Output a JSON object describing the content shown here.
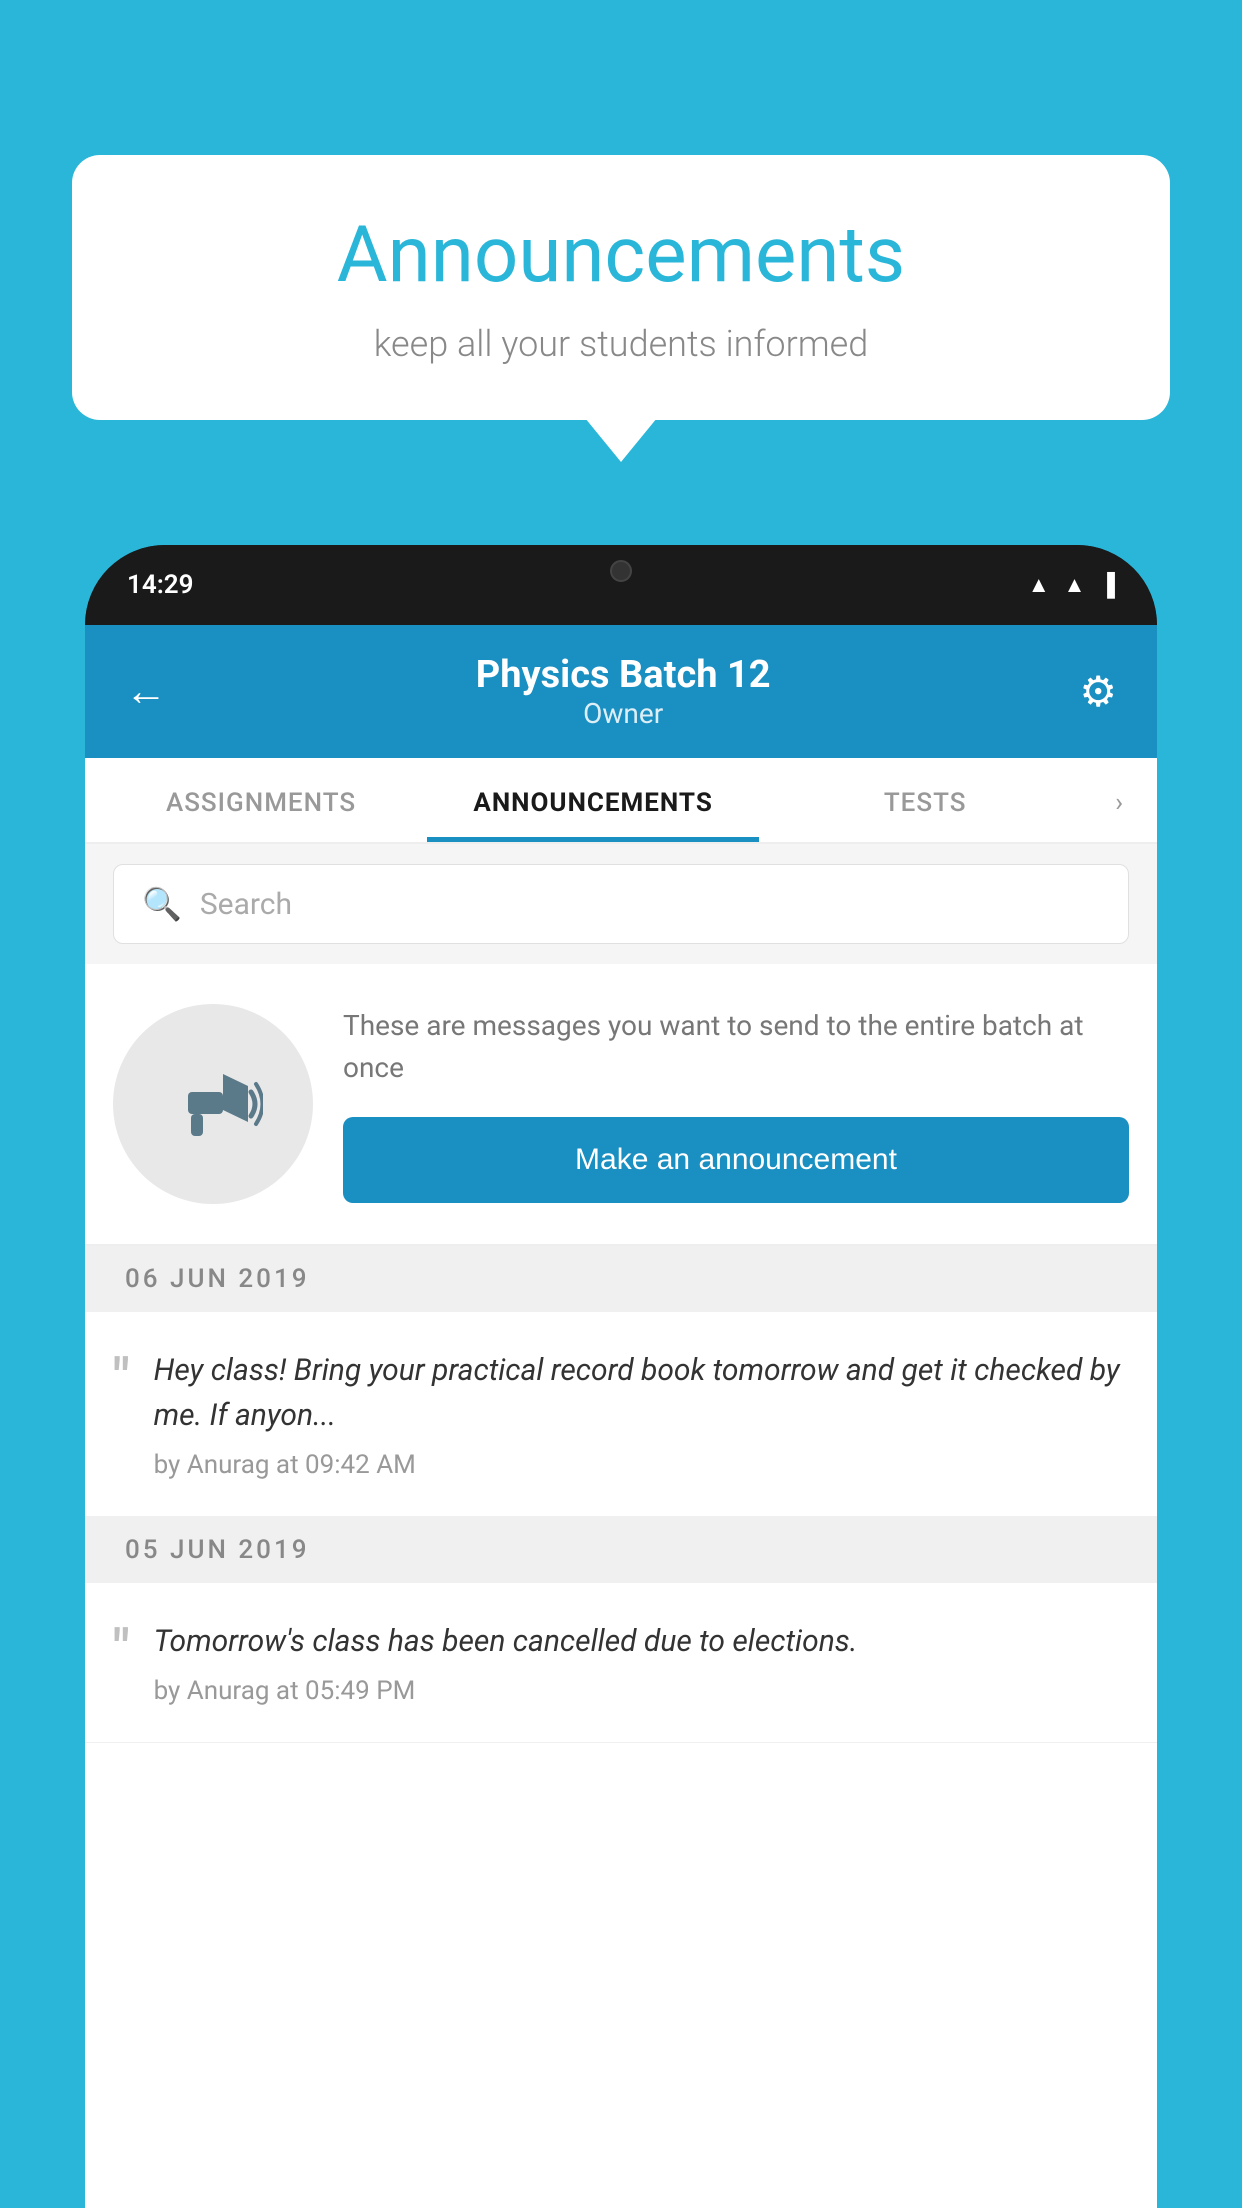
{
  "background_color": "#29b6d8",
  "speech_bubble": {
    "title": "Announcements",
    "subtitle": "keep all your students informed"
  },
  "status_bar": {
    "time": "14:29",
    "icons": [
      "wifi",
      "signal",
      "battery"
    ]
  },
  "app_header": {
    "back_label": "←",
    "title": "Physics Batch 12",
    "subtitle": "Owner",
    "gear_label": "⚙"
  },
  "tabs": [
    {
      "label": "ASSIGNMENTS",
      "active": false
    },
    {
      "label": "ANNOUNCEMENTS",
      "active": true
    },
    {
      "label": "TESTS",
      "active": false
    }
  ],
  "search": {
    "placeholder": "Search"
  },
  "promo": {
    "description": "These are messages you want to send to the entire batch at once",
    "button_label": "Make an announcement"
  },
  "date_groups": [
    {
      "date": "06  JUN  2019",
      "announcements": [
        {
          "text": "Hey class! Bring your practical record book tomorrow and get it checked by me. If anyon...",
          "meta": "by Anurag at 09:42 AM"
        }
      ]
    },
    {
      "date": "05  JUN  2019",
      "announcements": [
        {
          "text": "Tomorrow's class has been cancelled due to elections.",
          "meta": "by Anurag at 05:49 PM"
        }
      ]
    }
  ]
}
